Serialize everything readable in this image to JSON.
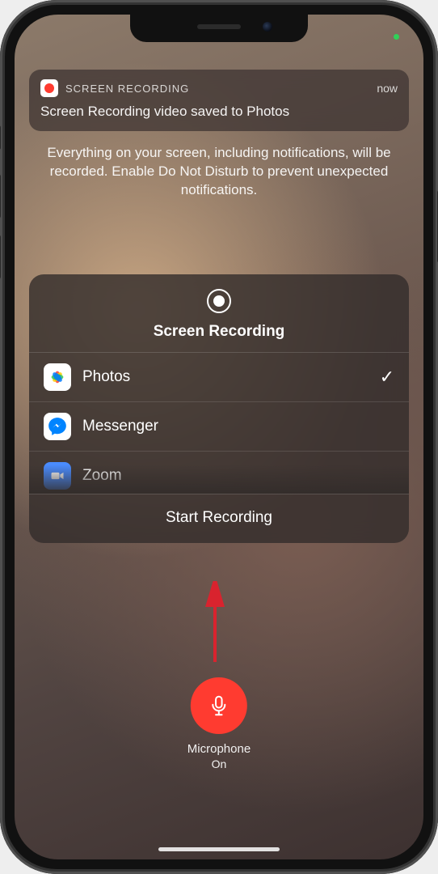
{
  "notification": {
    "app_name": "SCREEN RECORDING",
    "time": "now",
    "body": "Screen Recording video saved to Photos"
  },
  "disclaimer": "Everything on your screen, including notifications, will be recorded. Enable Do Not Disturb to prevent unexpected notifications.",
  "sheet": {
    "title": "Screen Recording",
    "start_label": "Start Recording",
    "apps": [
      {
        "label": "Photos",
        "icon": "photos-icon",
        "selected": true
      },
      {
        "label": "Messenger",
        "icon": "messenger-icon",
        "selected": false
      },
      {
        "label": "Zoom",
        "icon": "zoom-icon",
        "selected": false
      }
    ]
  },
  "microphone": {
    "label": "Microphone",
    "state": "On"
  }
}
